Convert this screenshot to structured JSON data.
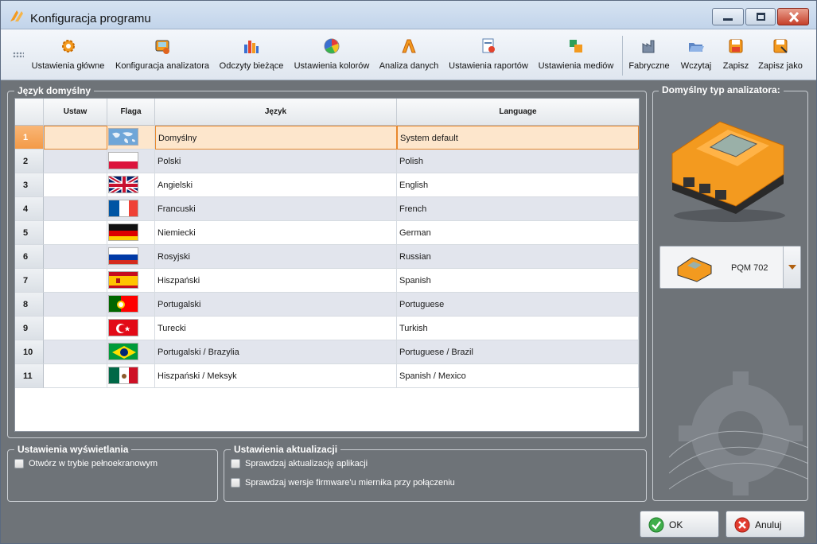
{
  "window": {
    "title": "Konfiguracja programu",
    "accent": "#f39a47"
  },
  "toolbar": {
    "items": [
      {
        "label": "Ustawienia główne",
        "icon": "gears-icon"
      },
      {
        "label": "Konfiguracja analizatora",
        "icon": "analyzer-config-icon"
      },
      {
        "label": "Odczyty bieżące",
        "icon": "bar-chart-icon"
      },
      {
        "label": "Ustawienia kolorów",
        "icon": "color-wheel-icon"
      },
      {
        "label": "Analiza danych",
        "icon": "analysis-icon"
      },
      {
        "label": "Ustawienia raportów",
        "icon": "report-icon"
      },
      {
        "label": "Ustawienia mediów",
        "icon": "media-icon"
      },
      {
        "label": "Fabryczne",
        "icon": "factory-reset-icon"
      },
      {
        "label": "Wczytaj",
        "icon": "load-icon"
      },
      {
        "label": "Zapisz",
        "icon": "save-icon"
      },
      {
        "label": "Zapisz jako",
        "icon": "save-as-icon"
      }
    ]
  },
  "language_group": {
    "title": "Język domyślny",
    "columns": [
      "Ustaw",
      "Flaga",
      "Język",
      "Language"
    ],
    "selected_row": 1,
    "rows": [
      {
        "num": "1",
        "pl": "Domyślny",
        "en": "System default",
        "flag": "world-map-flag"
      },
      {
        "num": "2",
        "pl": "Polski",
        "en": "Polish",
        "flag": "poland-flag"
      },
      {
        "num": "3",
        "pl": "Angielski",
        "en": "English",
        "flag": "uk-flag"
      },
      {
        "num": "4",
        "pl": "Francuski",
        "en": "French",
        "flag": "france-flag"
      },
      {
        "num": "5",
        "pl": "Niemiecki",
        "en": "German",
        "flag": "germany-flag"
      },
      {
        "num": "6",
        "pl": "Rosyjski",
        "en": "Russian",
        "flag": "russia-flag"
      },
      {
        "num": "7",
        "pl": "Hiszpański",
        "en": "Spanish",
        "flag": "spain-flag"
      },
      {
        "num": "8",
        "pl": "Portugalski",
        "en": "Portuguese",
        "flag": "portugal-flag"
      },
      {
        "num": "9",
        "pl": "Turecki",
        "en": "Turkish",
        "flag": "turkey-flag"
      },
      {
        "num": "10",
        "pl": "Portugalski / Brazylia",
        "en": "Portuguese / Brazil",
        "flag": "brazil-flag"
      },
      {
        "num": "11",
        "pl": "Hiszpański / Meksyk",
        "en": "Spanish / Mexico",
        "flag": "mexico-flag"
      }
    ]
  },
  "analyzer_group": {
    "title": "Domyślny typ analizatora:",
    "selected_model": "PQM 702"
  },
  "display_group": {
    "title": "Ustawienia wyświetlania",
    "fullscreen_label": "Otwórz w trybie pełnoekranowym",
    "fullscreen_checked": false
  },
  "update_group": {
    "title": "Ustawienia aktualizacji",
    "check_app_label": "Sprawdzaj aktualizację aplikacji",
    "check_app_checked": false,
    "check_fw_label": "Sprawdzaj wersje firmware'u miernika przy połączeniu",
    "check_fw_checked": false
  },
  "buttons": {
    "ok_label": "OK",
    "cancel_label": "Anuluj"
  }
}
